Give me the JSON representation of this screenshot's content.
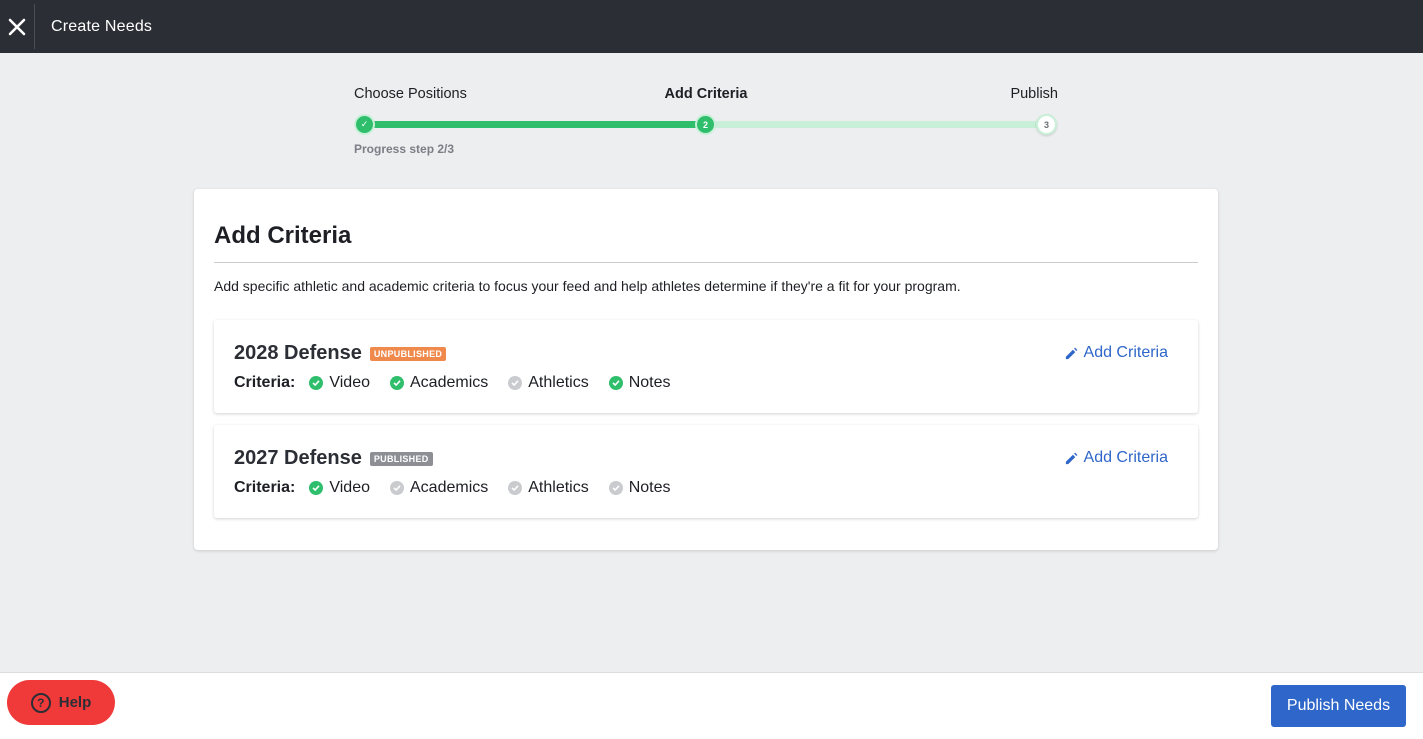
{
  "topbar": {
    "title": "Create Needs",
    "close_icon": "close-icon"
  },
  "stepper": {
    "steps": [
      {
        "label": "Choose Positions",
        "state": "done",
        "marker": "✓"
      },
      {
        "label": "Add Criteria",
        "state": "current",
        "marker": "2"
      },
      {
        "label": "Publish",
        "state": "todo",
        "marker": "3"
      }
    ],
    "progress_text": "Progress step 2/3",
    "progress_fraction": 0.5
  },
  "card": {
    "title": "Add Criteria",
    "description": "Add specific athletic and academic criteria to focus your feed and help athletes determine if they're a fit for your program.",
    "needs": [
      {
        "title": "2028 Defense",
        "badge": "UNPUBLISHED",
        "criteria_label": "Criteria:",
        "criteria": [
          {
            "label": "Video",
            "checked": true
          },
          {
            "label": "Academics",
            "checked": true
          },
          {
            "label": "Athletics",
            "checked": false
          },
          {
            "label": "Notes",
            "checked": true
          }
        ],
        "action": "Add Criteria"
      },
      {
        "title": "2027 Defense",
        "badge": "PUBLISHED",
        "criteria_label": "Criteria:",
        "criteria": [
          {
            "label": "Video",
            "checked": true
          },
          {
            "label": "Academics",
            "checked": false
          },
          {
            "label": "Athletics",
            "checked": false
          },
          {
            "label": "Notes",
            "checked": false
          }
        ],
        "action": "Add Criteria"
      }
    ]
  },
  "footer": {
    "help_label": "Help",
    "publish_label": "Publish Needs"
  },
  "colors": {
    "topbar": "#2c2e35",
    "accent_green": "#2fbf6c",
    "link_blue": "#2f66c9",
    "badge_unpublished": "#ef8a4c",
    "badge_published": "#8d8f95",
    "help_red": "#f03a3a"
  }
}
